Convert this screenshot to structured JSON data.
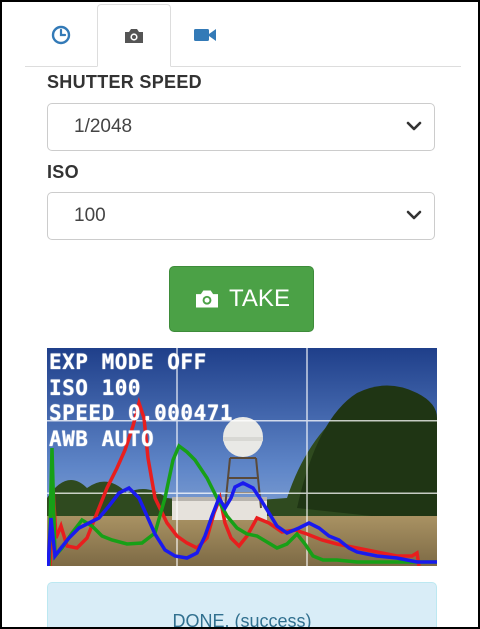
{
  "tabs": [
    {
      "icon": "clock-icon",
      "active": false
    },
    {
      "icon": "camera-icon",
      "active": true
    },
    {
      "icon": "video-camera-icon",
      "active": false
    }
  ],
  "shutter": {
    "label": "SHUTTER SPEED",
    "value": "1/2048"
  },
  "iso": {
    "label": "ISO",
    "value": "100"
  },
  "take_button": {
    "label": "TAKE",
    "icon": "camera-icon"
  },
  "preview_overlay": {
    "line1": "EXP MODE OFF",
    "line2": "ISO 100",
    "line3": "SPEED 0.000471",
    "line4": "AWB AUTO"
  },
  "status": {
    "text": "DONE. (success)"
  },
  "colors": {
    "accent": "#337ab7",
    "button": "#4ba146",
    "alert_bg": "#d9edf7",
    "alert_text": "#31708f"
  }
}
